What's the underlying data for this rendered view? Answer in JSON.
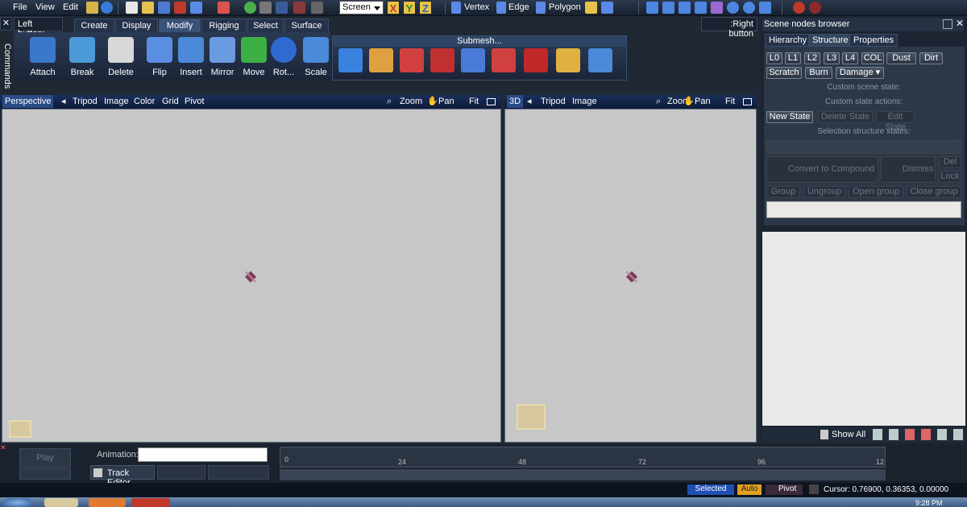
{
  "menu": {
    "file": "File",
    "view": "View",
    "edit": "Edit"
  },
  "toolbar": {
    "screen_select": "Screen",
    "axis_x": "X",
    "axis_y": "Y",
    "axis_z": "Z",
    "vertex": "Vertex",
    "edge": "Edge",
    "polygon": "Polygon"
  },
  "leftbar": {
    "left_button": "Left button:",
    "right_button": ":Right button",
    "commands": "Commands"
  },
  "tabs": [
    "Create",
    "Display",
    "Modify",
    "Rigging",
    "Select",
    "Surface"
  ],
  "tools": [
    "Attach",
    "Break",
    "Delete",
    "Flip",
    "Insert",
    "Mirror",
    "Move",
    "Rot...",
    "Scale"
  ],
  "submesh": {
    "title": "Submesh..."
  },
  "viewport_left": {
    "name": "Perspective",
    "tripod": "Tripod",
    "image": "Image",
    "color": "Color",
    "grid": "Grid",
    "pivot": "Pivot",
    "zoom": "Zoom",
    "pan": "Pan",
    "fit": "Fit"
  },
  "viewport_right": {
    "name": "3D",
    "tripod": "Tripod",
    "image": "Image",
    "zoom": "Zoom",
    "pan": "Pan",
    "fit": "Fit"
  },
  "scene_browser": {
    "title": "Scene nodes browser",
    "tabs": [
      "Hierarchy",
      "Structure",
      "Properties"
    ],
    "lod_buttons": [
      "L0",
      "L1",
      "L2",
      "L3",
      "L4",
      "COL",
      "Dust",
      "Dirt"
    ],
    "scratch": "Scratch",
    "burn": "Burn",
    "damage": "Damage",
    "custom_scene_state": "Custom scene state:",
    "custom_state_actions": "Custom state actions:",
    "new_state": "New State",
    "delete_state": "Delete State",
    "edit_state": "Edit State",
    "selection_structure_states": "Selection structure states:",
    "convert": "Convert to Compound",
    "dismiss": "Dismiss",
    "del": "Del",
    "lock": "Lock",
    "group": "Group",
    "ungroup": "Ungroup",
    "open_group": "Open group",
    "close_group": "Close group",
    "show_all": "Show All"
  },
  "bottom": {
    "play": "Play",
    "animation_label": "Animation:",
    "track_editor": "Track Editor",
    "timeline_ticks": [
      "0",
      "24",
      "48",
      "72",
      "96",
      "12"
    ]
  },
  "status": {
    "selected": "Selected",
    "auto": "Auto",
    "pivot": "Pivot",
    "cursor": "Cursor: 0.76900, 0.36353, 0.00000"
  },
  "taskbar": {
    "clock": "9:28 PM"
  },
  "colors": {
    "accent": "#3a5177",
    "viewport": "#c7c7c7",
    "selected_bg": "#1f4fb3",
    "auto_bg": "#e0a020"
  }
}
